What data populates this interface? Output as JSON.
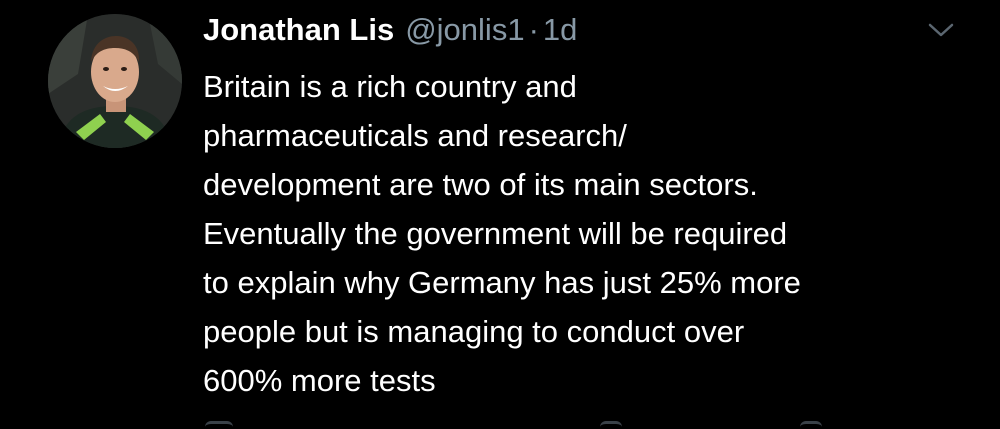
{
  "tweet": {
    "display_name": "Jonathan Lis",
    "handle": "@jonlis1",
    "separator": "·",
    "time": "1d",
    "body_lines": [
      "Britain is a rich country and",
      "pharmaceuticals and research/",
      "development are two of its main sectors.",
      "Eventually the government will be required",
      "to explain why Germany has just 25% more",
      "people but is managing to conduct over",
      "600% more tests"
    ],
    "caret_icon": "chevron-down-icon",
    "avatar_icon": "user-avatar"
  },
  "colors": {
    "background": "#000000",
    "text": "#ffffff",
    "secondary": "#8899a6"
  }
}
